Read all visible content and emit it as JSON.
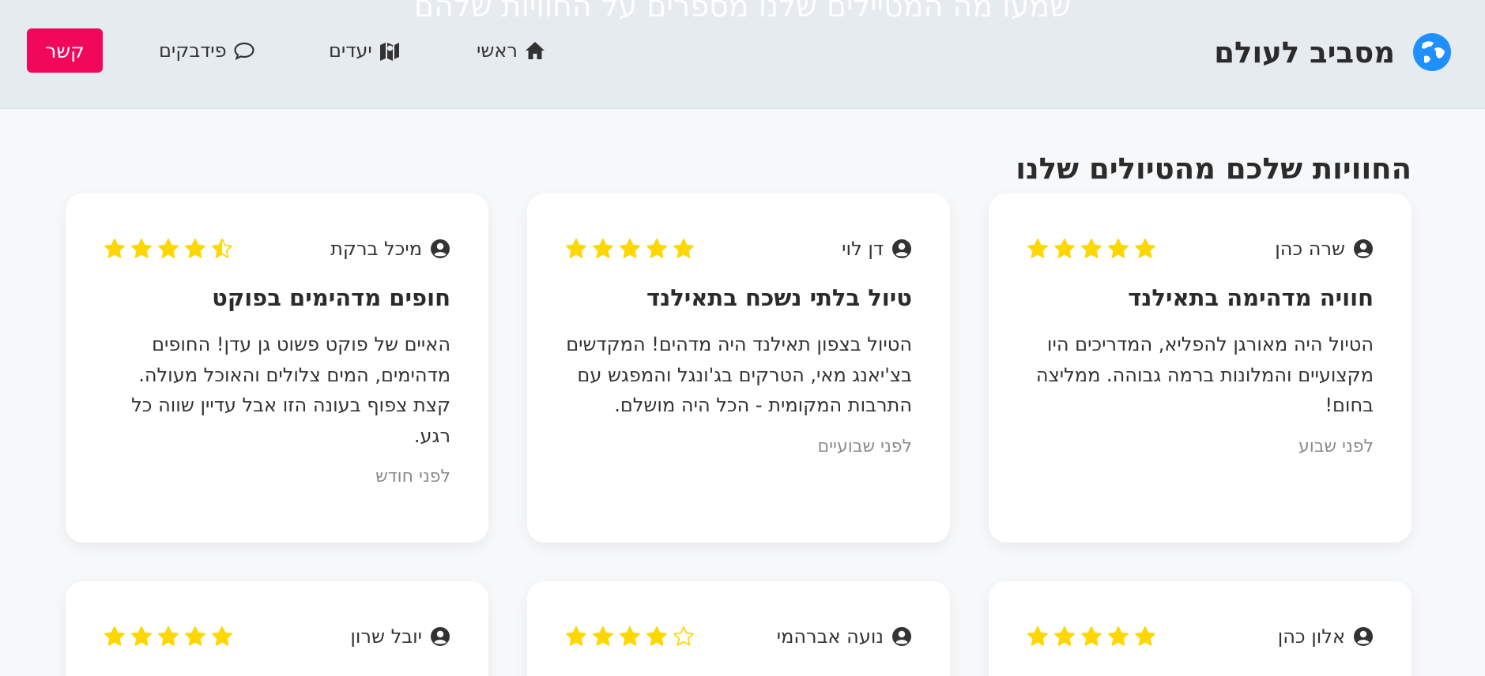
{
  "header": {
    "faded_subtitle": "שמעו מה המטיילים שלנו מספרים על החוויות שלהם",
    "brand_name": "מסביב לעולם",
    "brand_icon": "globe-icon",
    "nav": [
      {
        "label": "ראשי",
        "icon": "home-icon"
      },
      {
        "label": "יעדים",
        "icon": "map-icon"
      },
      {
        "label": "פידבקים",
        "icon": "comment-icon"
      }
    ],
    "contact_label": "קשר"
  },
  "colors": {
    "accent": "#f2085a",
    "star": "#ffd700",
    "brand_icon": "#1e90ff",
    "header_bg": "#e6ebf0"
  },
  "section": {
    "title": "החוויות שלכם מהטיולים שלנו"
  },
  "reviews": [
    {
      "name": "שרה כהן",
      "rating": 5,
      "title": "חוויה מדהימה בתאילנד",
      "text": "הטיול היה מאורגן להפליא, המדריכים היו מקצועיים והמלונות ברמה גבוהה. ממליצה בחום!",
      "time": "לפני שבוע"
    },
    {
      "name": "דן לוי",
      "rating": 5,
      "title": "טיול בלתי נשכח בתאילנד",
      "text": "הטיול בצפון תאילנד היה מדהים! המקדשים בצ'יאנג מאי, הטרקים בג'ונגל והמפגש עם התרבות המקומית - הכל היה מושלם.",
      "time": "לפני שבועיים"
    },
    {
      "name": "מיכל ברקת",
      "rating": 4.5,
      "title": "חופים מדהימים בפוקט",
      "text": "האיים של פוקט פשוט גן עדן! החופים מדהימים, המים צלולים והאוכל מעולה. קצת צפוף בעונה הזו אבל עדיין שווה כל רגע.",
      "time": "לפני חודש"
    },
    {
      "name": "אלון כהן",
      "rating": 5
    },
    {
      "name": "נועה אברהמי",
      "rating": 4
    },
    {
      "name": "יובל שרון",
      "rating": 5
    }
  ]
}
